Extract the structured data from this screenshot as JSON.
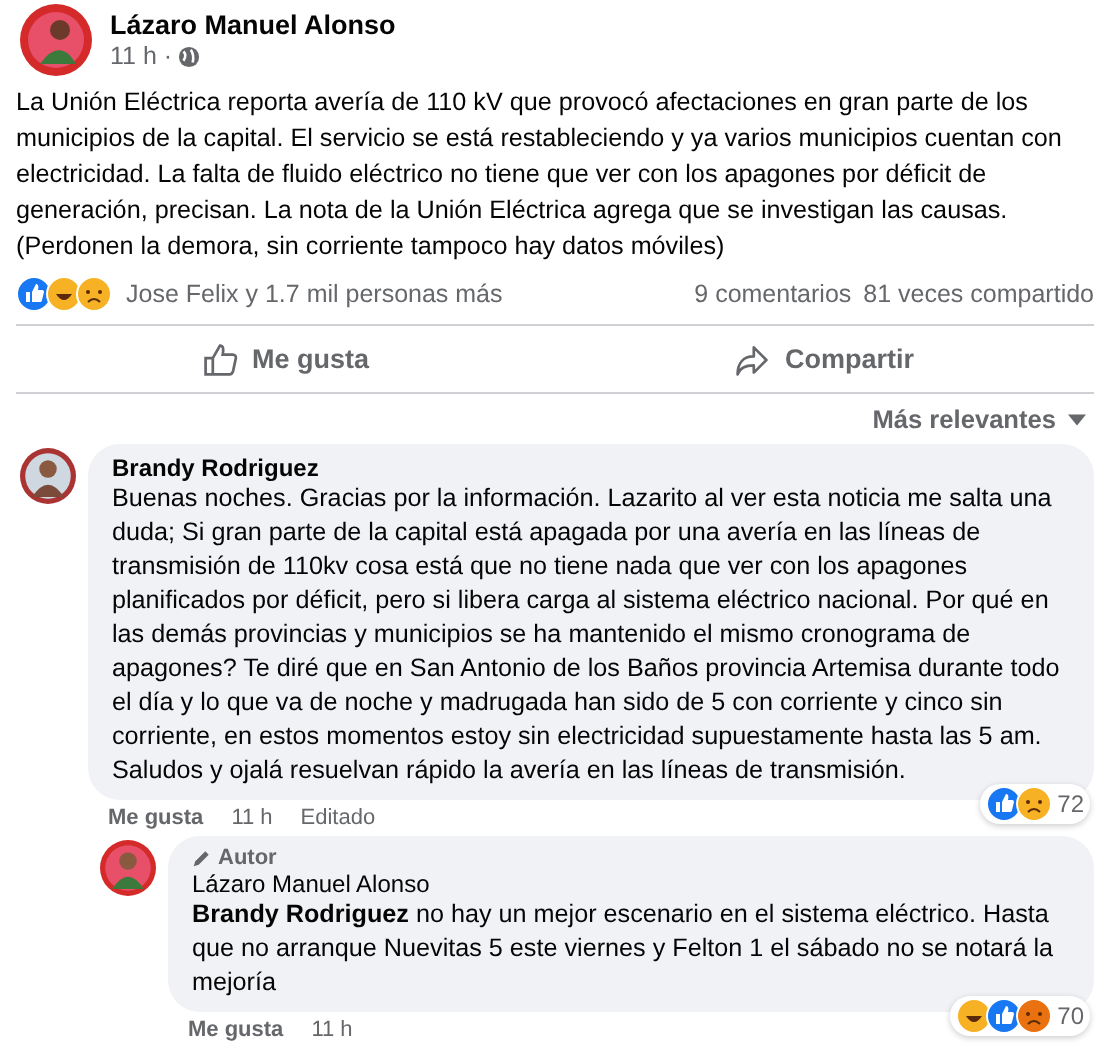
{
  "post": {
    "author": "Lázaro Manuel Alonso",
    "time": "11 h ·",
    "text": "La Unión Eléctrica reporta avería de 110 kV que provocó afectaciones en gran parte de los municipios de la capital. El servicio se está restableciendo y ya varios municipios cuentan con electricidad. La falta de fluido eléctrico no tiene que ver con los apagones por déficit de generación,  precisan. La nota de la Unión Eléctrica agrega que se investigan las causas. (Perdonen la demora,  sin corriente tampoco hay datos móviles)",
    "reactions": [
      {
        "kind": "like"
      },
      {
        "kind": "haha"
      },
      {
        "kind": "sad"
      }
    ],
    "reactors": "Jose Felix y 1.7 mil personas más",
    "comments_count": "9 comentarios",
    "shares": "81 veces compartido",
    "actions": [
      {
        "kind": "like",
        "label": "Me gusta"
      },
      {
        "kind": "share",
        "label": "Compartir"
      }
    ]
  },
  "sort": "Más relevantes",
  "comments": [
    {
      "author": "Brandy Rodriguez",
      "text": "Buenas noches. Gracias por la información. Lazarito al ver esta noticia me salta una duda; Si gran parte de la capital está apagada por una avería en las líneas de transmisión de 110kv cosa está que no tiene nada que ver con los apagones planificados por déficit, pero si libera carga al sistema eléctrico nacional. Por qué en las demás provincias y municipios se ha mantenido el mismo cronograma de apagones? Te diré que en San Antonio de los Baños provincia Artemisa durante todo el día y lo que va de noche y madrugada han sido de 5 con corriente y cinco sin corriente, en estos momentos estoy sin electricidad supuestamente hasta las 5 am. Saludos y ojalá resuelvan rápido la avería en las líneas de transmisión.",
      "like": "Me gusta",
      "time": "11 h",
      "edited": "Editado",
      "reactions": [
        {
          "kind": "like"
        },
        {
          "kind": "sad"
        }
      ],
      "count": "72",
      "reply": false
    },
    {
      "author": "Lázaro Manuel Alonso",
      "badge": "Autor",
      "mention": "Brandy Rodriguez",
      "text": " no hay un mejor escenario en el sistema eléctrico. Hasta que no arranque Nuevitas 5 este viernes y Felton 1 el sábado no se notará la mejoría",
      "like": "Me gusta",
      "time": "11 h",
      "reactions": [
        {
          "kind": "haha"
        },
        {
          "kind": "like"
        },
        {
          "kind": "angry"
        }
      ],
      "count": "70",
      "reply": true
    }
  ]
}
